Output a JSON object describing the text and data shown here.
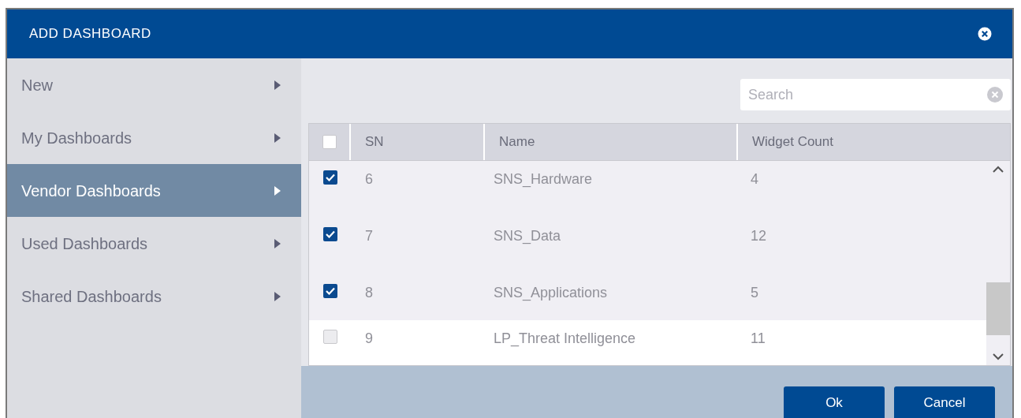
{
  "dialog": {
    "title": "ADD DASHBOARD"
  },
  "sidebar": {
    "items": [
      {
        "label": "New",
        "selected": false
      },
      {
        "label": "My Dashboards",
        "selected": false
      },
      {
        "label": "Vendor Dashboards",
        "selected": true
      },
      {
        "label": "Used Dashboards",
        "selected": false
      },
      {
        "label": "Shared Dashboards",
        "selected": false
      }
    ]
  },
  "search": {
    "placeholder": "Search"
  },
  "table": {
    "select_all_checked": false,
    "columns": [
      "SN",
      "Name",
      "Widget Count"
    ],
    "rows": [
      {
        "sn": "6",
        "name": "SNS_Hardware",
        "widget_count": "4",
        "selected": true
      },
      {
        "sn": "7",
        "name": "SNS_Data",
        "widget_count": "12",
        "selected": true
      },
      {
        "sn": "8",
        "name": "SNS_Applications",
        "widget_count": "5",
        "selected": true
      },
      {
        "sn": "9",
        "name": "LP_Threat Intelligence",
        "widget_count": "11",
        "selected": false
      }
    ]
  },
  "buttons": [
    "Ok",
    "Cancel"
  ]
}
